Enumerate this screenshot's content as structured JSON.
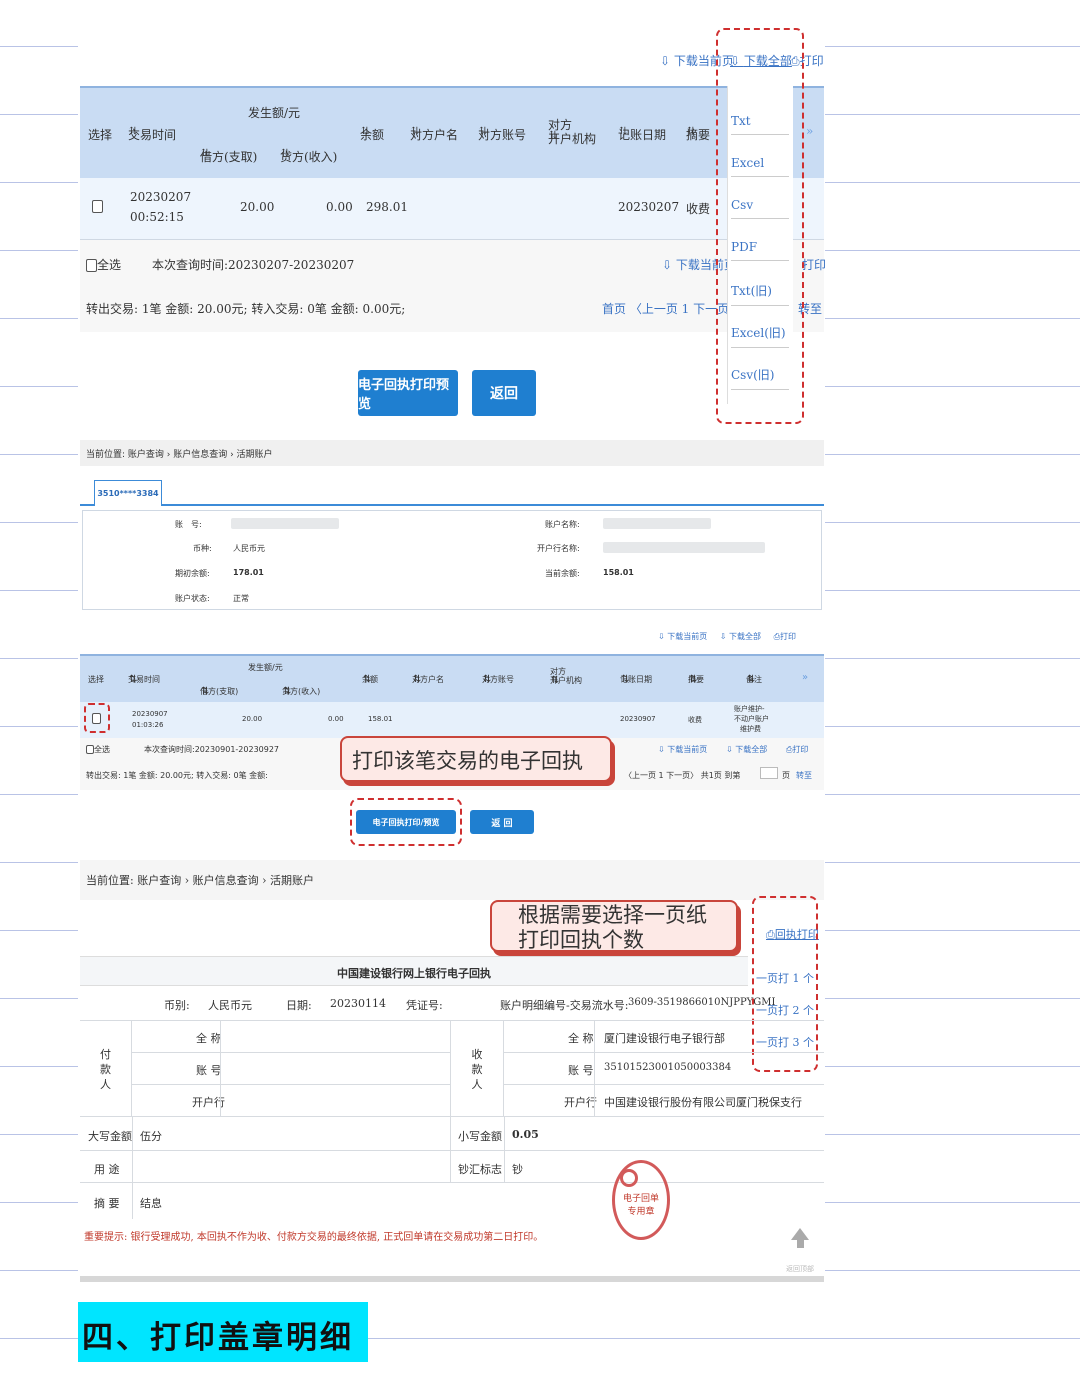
{
  "s1": {
    "dl_current": "下载当前页",
    "dl_all": "下载全部",
    "print": "打印",
    "dropdown": [
      "Txt",
      "Excel",
      "Csv",
      "PDF",
      "Txt(旧)",
      "Excel(旧)",
      "Csv(旧)"
    ],
    "headers": {
      "select": "选择",
      "time": "交易时间",
      "amount_group": "发生额/元",
      "debit": "借方(支取)",
      "credit": "贷方(收入)",
      "balance": "余额",
      "cp_name": "对方户名",
      "cp_acct": "对方账号",
      "cp_org_1": "对方",
      "cp_org_2": "开户机构",
      "date": "记账日期",
      "summary": "摘要",
      "more": "»"
    },
    "row": {
      "date": "20230207",
      "time": "00:52:15",
      "debit": "20.00",
      "credit": "0.00",
      "balance": "298.01",
      "post_date": "20230207",
      "summary": "收费"
    },
    "footer": {
      "select_all": "全选",
      "query_period": "本次查询时间:20230207-20230207",
      "totals": "转出交易: 1笔   金额: 20.00元;    转入交易: 0笔   金额: 0.00元;",
      "pager": "首页 〈上一页  1  下一页〉末",
      "jump": "转至"
    },
    "btn_preview": "电子回执打印预览",
    "btn_back": "返回"
  },
  "s2": {
    "breadcrumb": "当前位置: 账户查询 › 账户信息查询 › 活期账户",
    "tab": "3510****3384",
    "info": {
      "acct_label": "账　号:",
      "currency_label": "币种:",
      "currency": "人民币元",
      "open_bal_label": "期初余额:",
      "open_bal": "178.01",
      "status_label": "账户状态:",
      "status": "正常",
      "name_label": "账户名称:",
      "bank_label": "开户行名称:",
      "cur_bal_label": "当前余额:",
      "cur_bal": "158.01"
    },
    "dl_current": "下载当前页",
    "dl_all": "下载全部",
    "print": "打印",
    "headers": {
      "select": "选择",
      "time": "交易时间",
      "amount_group": "发生额/元",
      "debit": "借方(支取)",
      "credit": "贷方(收入)",
      "balance": "余额",
      "cp_name": "对方户名",
      "cp_acct": "对方账号",
      "cp_org_1": "对方",
      "cp_org_2": "开户机构",
      "date": "记账日期",
      "summary": "摘要",
      "remark": "备注",
      "more": "»"
    },
    "row": {
      "date": "20230907",
      "time": "01:03:26",
      "debit": "20.00",
      "credit": "0.00",
      "balance": "158.01",
      "post_date": "20230907",
      "summary": "收费",
      "remark_1": "账户维护-",
      "remark_2": "不动户账户",
      "remark_3": "维护费"
    },
    "footer": {
      "select_all": "全选",
      "query_period": "本次查询时间:20230901-20230927",
      "totals": "转出交易: 1笔   金额: 20.00元;   转入交易: 0笔   金额:",
      "pager": "〈上一页  1  下一页〉 共1页  到第",
      "page_unit": "页",
      "jump": "转至"
    },
    "callout": "打印该笔交易的电子回执",
    "btn_preview": "电子回执打印/预览",
    "btn_back": "返 回"
  },
  "s3": {
    "breadcrumb": "当前位置: 账户查询 › 账户信息查询 › 活期账户",
    "callout_1": "根据需要选择一页纸",
    "callout_2": "打印回执个数",
    "print_btn": "回执打印",
    "print_options": [
      "一页打 1 个",
      "一页打 2 个",
      "一页打 3 个"
    ],
    "title": "中国建设银行网上银行电子回执",
    "meta": {
      "currency_label": "币别:",
      "currency": "人民币元",
      "date_label": "日期:",
      "date": "20230114",
      "voucher_label": "凭证号:",
      "serial_label": "账户明细编号-交易流水号:",
      "serial": "3609-3519866010NJPPYGMI"
    },
    "payer_label": "付款人",
    "payee_label": "收款人",
    "full_name": "全 称",
    "account": "账 号",
    "bank": "开户行",
    "payee_name": "厦门建设银行电子银行部",
    "payee_acct": "35101523001050003384",
    "payee_bank": "中国建设银行股份有限公司厦门税保支行",
    "amt_cn_label": "大写金额",
    "amt_cn": "伍分",
    "amt_label": "小写金额",
    "amt": "0.05",
    "purpose_label": "用 途",
    "cash_label": "钞汇标志",
    "cash": "钞",
    "summary_label": "摘 要",
    "summary": "结息",
    "notice": "重要提示: 银行受理成功, 本回执不作为收、付款方交易的最终依据, 正式回单请在交易成功第二日打印。",
    "seal_1": "电子回单",
    "seal_2": "专用章",
    "back_top": "返回顶部"
  },
  "heading": "四、打印盖章明细",
  "colors": {
    "header_bg": "#c9dcf3",
    "button": "#1f7fd0",
    "annotation_red": "#cf2f2f",
    "heading_bg": "#00e5ff",
    "rule": "#b9c3e6"
  }
}
